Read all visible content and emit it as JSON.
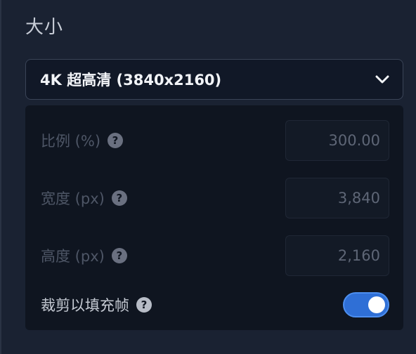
{
  "section": {
    "title": "大小"
  },
  "size_select": {
    "value": "4K 超高清 (3840x2160)"
  },
  "fields": {
    "scale": {
      "label": "比例 (%)",
      "value": "300.00"
    },
    "width": {
      "label": "宽度 (px)",
      "value": "3,840"
    },
    "height": {
      "label": "高度 (px)",
      "value": "2,160"
    }
  },
  "crop": {
    "label": "裁剪以填充帧",
    "enabled": true
  },
  "icons": {
    "help": "?",
    "chevron": "chevron-down-icon"
  },
  "colors": {
    "accent": "#2f6fd6",
    "background": "#1a2232",
    "subpanel": "#0f1520"
  }
}
